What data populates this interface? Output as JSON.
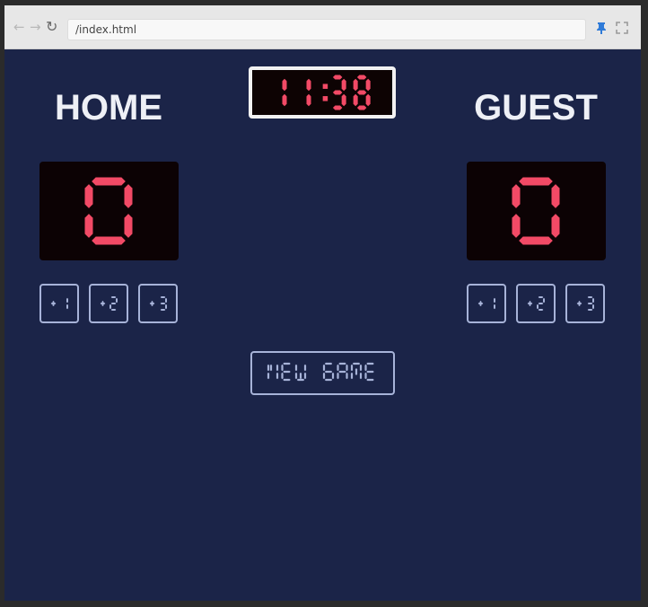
{
  "browser": {
    "url": "/index.html",
    "icons": [
      "back-arrow-icon",
      "forward-arrow-icon",
      "reload-icon",
      "pin-icon",
      "fullscreen-icon"
    ]
  },
  "scoreboard": {
    "clock": "11:38",
    "home": {
      "title": "HOME",
      "score": "0",
      "buttons": [
        "+1",
        "+2",
        "+3"
      ]
    },
    "guest": {
      "title": "GUEST",
      "score": "0",
      "buttons": [
        "+1",
        "+2",
        "+3"
      ]
    },
    "new_game_label": "NEW GAME"
  },
  "colors": {
    "background": "#1b2448",
    "display": "#0c0204",
    "digit": "#f24a66",
    "button_border": "#a7b3d8",
    "title": "#eef0f6"
  }
}
